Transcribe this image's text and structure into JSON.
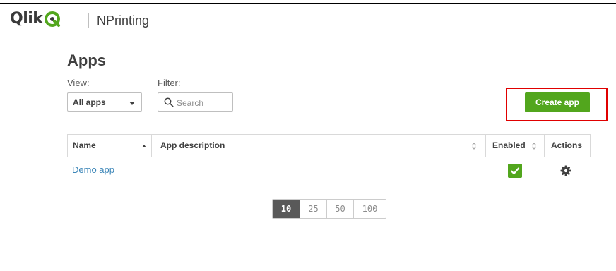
{
  "header": {
    "logo_text": "Qlik",
    "product_name": "NPrinting"
  },
  "page": {
    "title": "Apps",
    "view_label": "View:",
    "filter_label": "Filter:",
    "view_selected": "All apps",
    "search_placeholder": "Search",
    "create_button": "Create app"
  },
  "table": {
    "columns": [
      "Name",
      "App description",
      "Enabled",
      "Actions"
    ],
    "rows": [
      {
        "name": "Demo app",
        "description": "",
        "enabled": true
      }
    ]
  },
  "pagination": {
    "sizes": [
      "10",
      "25",
      "50",
      "100"
    ],
    "active": "10"
  },
  "colors": {
    "accent_green": "#52a61d",
    "link_blue": "#3c86b8",
    "highlight_red": "#e00000"
  },
  "icons": [
    "qlik-logo-icon",
    "chevron-down-icon",
    "search-icon",
    "sort-asc-icon",
    "sort-icon",
    "checkmark-icon",
    "gear-icon"
  ]
}
